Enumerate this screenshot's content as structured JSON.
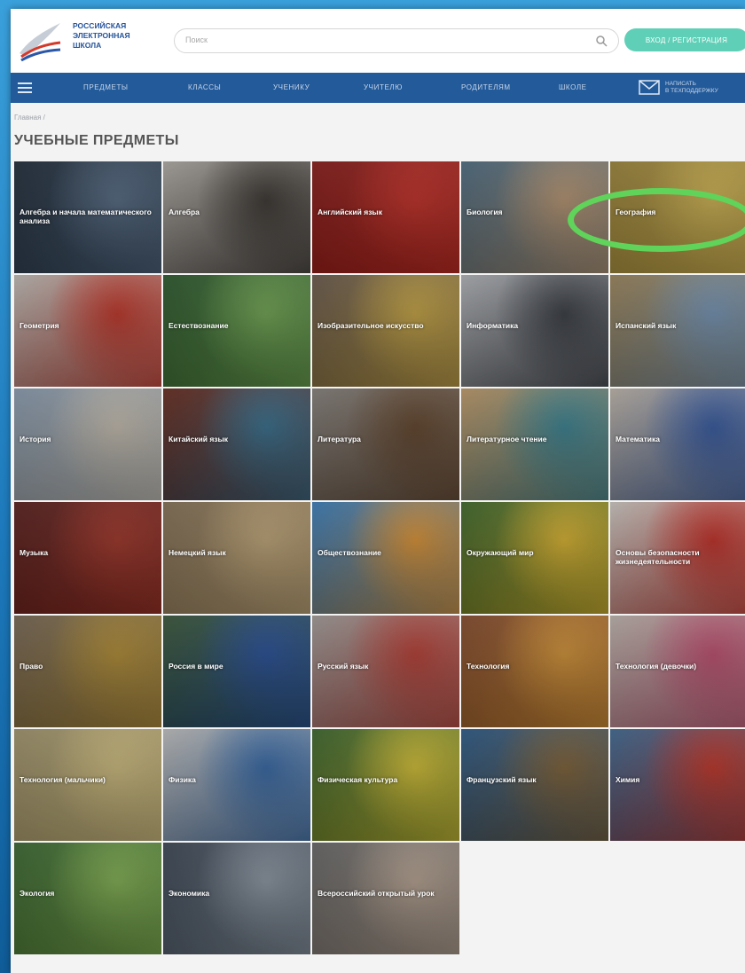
{
  "header": {
    "logo_lines": [
      "РОССИЙСКАЯ",
      "ЭЛЕКТРОННАЯ",
      "ШКОЛА"
    ],
    "search_placeholder": "Поиск",
    "login_label": "ВХОД / РЕГИСТРАЦИЯ"
  },
  "nav": {
    "items": [
      "ПРЕДМЕТЫ",
      "КЛАССЫ",
      "УЧЕНИКУ",
      "УЧИТЕЛЮ",
      "РОДИТЕЛЯМ",
      "ШКОЛЕ"
    ],
    "mail_lines": [
      "НАПИСАТЬ",
      "В ТЕХПОДДЕРЖКУ"
    ]
  },
  "breadcrumb": "Главная /",
  "page_title": "УЧЕБНЫЕ ПРЕДМЕТЫ",
  "subjects": [
    {
      "label": "Алгебра и начала математического анализа",
      "color": "#1e2b3a",
      "accent": "#5d7590"
    },
    {
      "label": "Алгебра",
      "color": "#b8b3ad",
      "accent": "#3f3a35"
    },
    {
      "label": "Английский язык",
      "color": "#8c1a17",
      "accent": "#d6332a"
    },
    {
      "label": "Биология",
      "color": "#4f6f86",
      "accent": "#c8a37c"
    },
    {
      "label": "География",
      "color": "#a2893a",
      "accent": "#e3c45a"
    },
    {
      "label": "Геометрия",
      "color": "#c9c5bf",
      "accent": "#d33a2c"
    },
    {
      "label": "Естествознание",
      "color": "#2b5a2c",
      "accent": "#7cb65b"
    },
    {
      "label": "Изобразительное искусство",
      "color": "#6d5c4d",
      "accent": "#d9b44a"
    },
    {
      "label": "Информатика",
      "color": "#b9bcc1",
      "accent": "#3d4148"
    },
    {
      "label": "Испанский язык",
      "color": "#a28a5e",
      "accent": "#7fa2c6"
    },
    {
      "label": "История",
      "color": "#8ea1b6",
      "accent": "#d8cfc0"
    },
    {
      "label": "Китайский язык",
      "color": "#6b2a1c",
      "accent": "#3c7a9c"
    },
    {
      "label": "Литература",
      "color": "#8a8580",
      "accent": "#6a4a2f"
    },
    {
      "label": "Литературное чтение",
      "color": "#c8a06c",
      "accent": "#3f8fa0"
    },
    {
      "label": "Математика",
      "color": "#c7bdb1",
      "accent": "#3a62b0"
    },
    {
      "label": "Музыка",
      "color": "#5a1e1c",
      "accent": "#b03a2c"
    },
    {
      "label": "Немецкий язык",
      "color": "#8a7458",
      "accent": "#d2b683"
    },
    {
      "label": "Обществознание",
      "color": "#3b83c5",
      "accent": "#f2a23a"
    },
    {
      "label": "Окружающий мир",
      "color": "#3f6c2a",
      "accent": "#f0c534"
    },
    {
      "label": "Основы безопасности жизнедеятельности",
      "color": "#d7d2cc",
      "accent": "#d6332a"
    },
    {
      "label": "Право",
      "color": "#7a6a56",
      "accent": "#c29a3a"
    },
    {
      "label": "Россия в мире",
      "color": "#3a5a3a",
      "accent": "#2b57a8"
    },
    {
      "label": "Русский язык",
      "color": "#a9a3a0",
      "accent": "#c9443a"
    },
    {
      "label": "Технология",
      "color": "#8a4c2c",
      "accent": "#e8a23c"
    },
    {
      "label": "Технология (девочки)",
      "color": "#c7bdb5",
      "accent": "#d1567a"
    },
    {
      "label": "Технология (мальчики)",
      "color": "#a79a70",
      "accent": "#e3cf8a"
    },
    {
      "label": "Физика",
      "color": "#c9c9c9",
      "accent": "#3a72b6"
    },
    {
      "label": "Физическая культура",
      "color": "#3c6a2c",
      "accent": "#e8d23a"
    },
    {
      "label": "Французский язык",
      "color": "#2c5d8e",
      "accent": "#8a6a3c"
    },
    {
      "label": "Химия",
      "color": "#3f6d9a",
      "accent": "#d33a2c"
    },
    {
      "label": "Экология",
      "color": "#3a6a30",
      "accent": "#8fc25a"
    },
    {
      "label": "Экономика",
      "color": "#3b4756",
      "accent": "#9aa6b3"
    },
    {
      "label": "Всероссийский открытый урок",
      "color": "#6a6a6a",
      "accent": "#c9b3a0"
    }
  ]
}
